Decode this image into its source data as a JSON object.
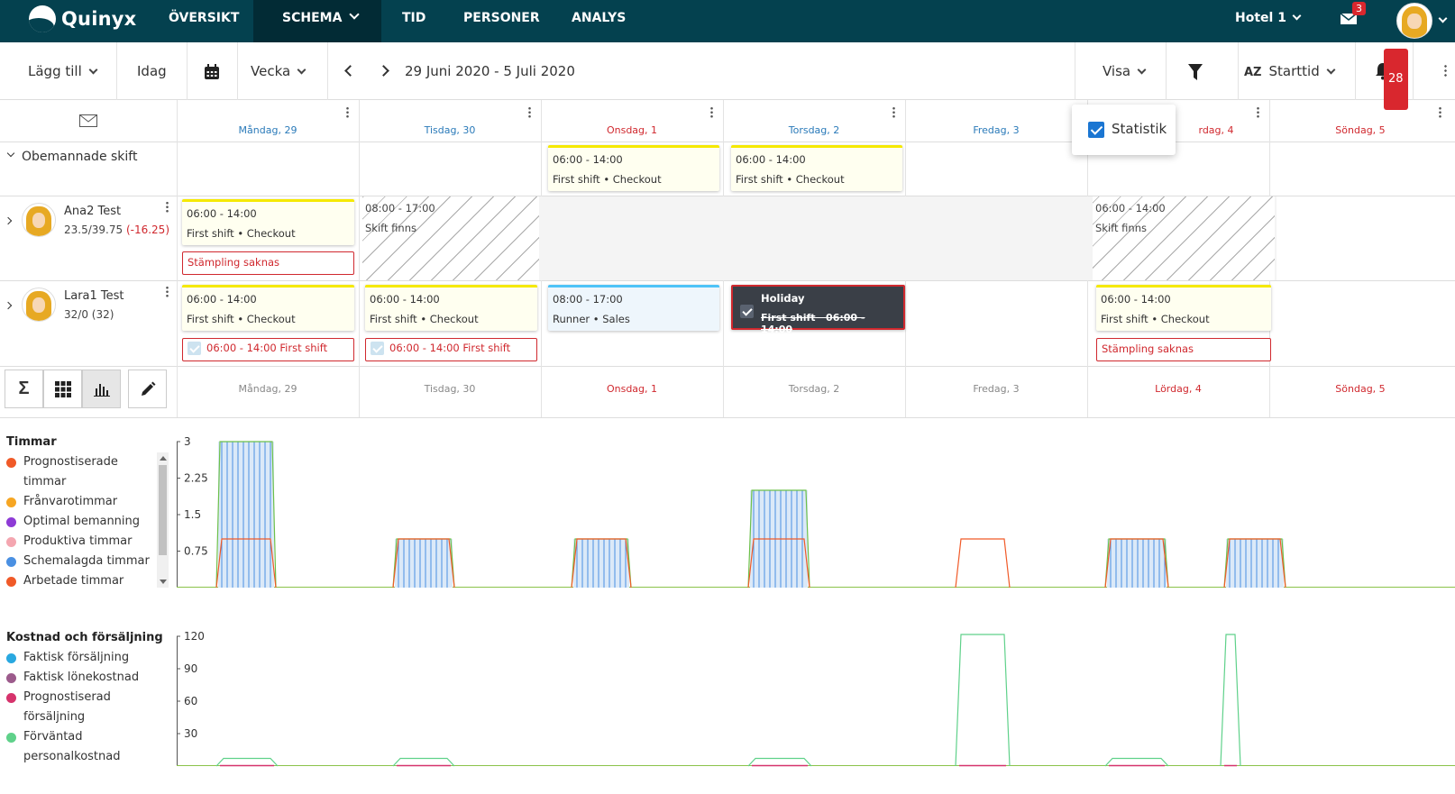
{
  "app": {
    "brand": "Quinyx"
  },
  "nav": {
    "items": [
      {
        "label": "ÖVERSIKT"
      },
      {
        "label": "SCHEMA"
      },
      {
        "label": "TID"
      },
      {
        "label": "PERSONER"
      },
      {
        "label": "ANALYS"
      }
    ],
    "active": "SCHEMA",
    "unit": "Hotel 1",
    "mail_badge": "3"
  },
  "toolbar": {
    "add": "Lägg till",
    "today": "Idag",
    "period": "Vecka",
    "date_range": "29 Juni 2020 - 5 Juli 2020",
    "view": "Visa",
    "sort": "Starttid",
    "sort_icon": "AZ",
    "notifications_badge": "28"
  },
  "popover": {
    "statistik": "Statistik",
    "checked": true
  },
  "days": [
    {
      "label": "Måndag, 29",
      "color": "blue"
    },
    {
      "label": "Tisdag, 30",
      "color": "blue"
    },
    {
      "label": "Onsdag, 1",
      "color": "red"
    },
    {
      "label": "Torsdag, 2",
      "color": "blue"
    },
    {
      "label": "Fredag, 3",
      "color": "blue"
    },
    {
      "label": "Lördag, 4",
      "color": "red"
    },
    {
      "label": "Söndag, 5",
      "color": "red"
    }
  ],
  "day_header_partial_saturday": "rdag, 4",
  "rows": {
    "unmanned": {
      "label": "Obemannade skift",
      "shifts": [
        {
          "time": "06:00 - 14:00",
          "desc": "First shift • Checkout"
        },
        {
          "time": "06:00 - 14:00",
          "desc": "First shift • Checkout"
        }
      ]
    },
    "ana": {
      "name": "Ana2 Test",
      "hours": "23.5/39.75",
      "diff": "(-16.25)",
      "shift": {
        "time": "06:00 - 14:00",
        "desc": "First shift • Checkout"
      },
      "stamp": "Stämpling saknas",
      "unavail1": {
        "time": "08:00 - 17:00",
        "desc": "Skift finns"
      },
      "unavail2": {
        "time": "06:00 - 14:00",
        "desc": "Skift finns"
      }
    },
    "lara": {
      "name": "Lara1 Test",
      "hours": "32/0",
      "diff": "(32)",
      "shifts": [
        {
          "time": "06:00 - 14:00",
          "desc": "First shift • Checkout"
        },
        {
          "time": "06:00 - 14:00",
          "desc": "First shift • Checkout"
        },
        {
          "time": "08:00 - 17:00",
          "desc": "Runner • Sales"
        },
        {
          "time": "06:00 - 14:00",
          "desc": "First shift • Checkout"
        }
      ],
      "holiday": {
        "title": "Holiday",
        "desc": "First shift",
        "time": "06:00 - 14:00"
      },
      "punch1": "06:00 - 14:00 First shift",
      "punch2": "06:00 - 14:00 First shift",
      "stamp": "Stämpling saknas"
    }
  },
  "stats": {
    "hours_title": "Timmar",
    "hours_legend": [
      {
        "label": "Prognostiserade timmar",
        "color": "#f05a28"
      },
      {
        "label": "Frånvarotimmar",
        "color": "#f6a623"
      },
      {
        "label": "Optimal bemanning",
        "color": "#8e3bd6"
      },
      {
        "label": "Produktiva timmar",
        "color": "#f4a6b0"
      },
      {
        "label": "Schemalagda timmar",
        "color": "#4a90e2"
      },
      {
        "label": "Arbetade timmar",
        "color": "#f05a28"
      }
    ],
    "cost_title": "Kostnad och försäljning",
    "cost_legend": [
      {
        "label": "Faktisk försäljning",
        "color": "#29a8e0"
      },
      {
        "label": "Faktisk lönekostnad",
        "color": "#9c5b8c"
      },
      {
        "label": "Prognostiserad försäljning",
        "color": "#d6336c"
      },
      {
        "label": "Förväntad personalkostnad",
        "color": "#5fd18a"
      }
    ]
  },
  "chart_data": [
    {
      "type": "area",
      "title": "Timmar",
      "yticks": [
        "3",
        "2.25",
        "1.5",
        "0.75"
      ],
      "ylim": [
        0,
        3
      ],
      "categories": [
        "Måndag, 29",
        "Tisdag, 30",
        "Onsdag, 1",
        "Torsdag, 2",
        "Fredag, 3",
        "Lördag, 4",
        "Söndag, 5"
      ],
      "series": [
        {
          "name": "Schemalagda timmar",
          "values": [
            3,
            1,
            1,
            2,
            0,
            1,
            1
          ]
        },
        {
          "name": "Prognostiserade timmar",
          "values": [
            1,
            1,
            1,
            1,
            1,
            1,
            1
          ]
        }
      ]
    },
    {
      "type": "line",
      "title": "Kostnad och försäljning",
      "yticks": [
        "120",
        "90",
        "60",
        "30"
      ],
      "ylim": [
        0,
        120
      ],
      "categories": [
        "Måndag, 29",
        "Tisdag, 30",
        "Onsdag, 1",
        "Torsdag, 2",
        "Fredag, 3",
        "Lördag, 4",
        "Söndag, 5"
      ],
      "series": [
        {
          "name": "Förväntad personalkostnad",
          "values": [
            7,
            7,
            0,
            7,
            120,
            7,
            120
          ]
        }
      ]
    }
  ]
}
